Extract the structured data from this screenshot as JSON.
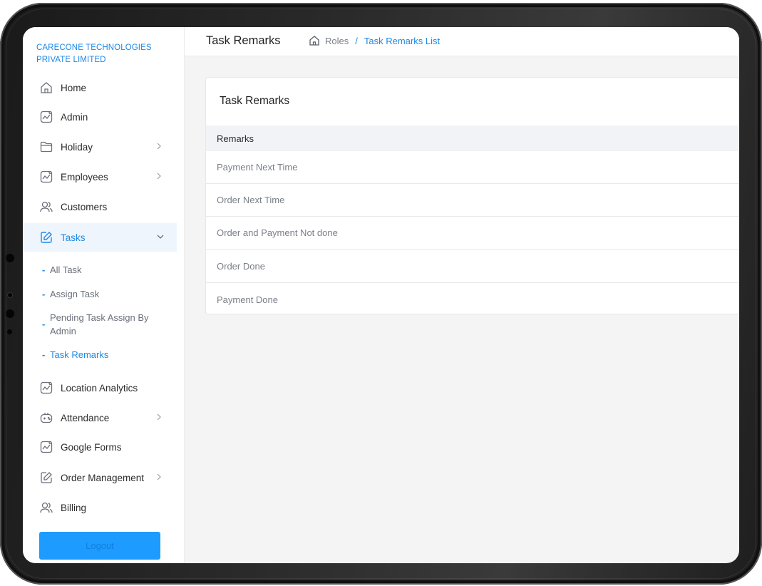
{
  "company": "CARECONE TECHNOLOGIES PRIVATE LIMITED",
  "sidebar": {
    "items": [
      {
        "label": "Home",
        "icon": "home-icon"
      },
      {
        "label": "Admin",
        "icon": "chart-icon"
      },
      {
        "label": "Holiday",
        "icon": "folder-icon",
        "has_submenu": true
      },
      {
        "label": "Employees",
        "icon": "chart-icon",
        "has_submenu": true
      },
      {
        "label": "Customers",
        "icon": "users-icon"
      },
      {
        "label": "Tasks",
        "icon": "edit-icon",
        "expanded": true,
        "active": true
      },
      {
        "label": "Location Analytics",
        "icon": "chart-icon"
      },
      {
        "label": "Attendance",
        "icon": "gamepad-icon",
        "has_submenu": true
      },
      {
        "label": "Google Forms",
        "icon": "chart-icon"
      },
      {
        "label": "Order Management",
        "icon": "edit-icon",
        "has_submenu": true
      },
      {
        "label": "Billing",
        "icon": "users-icon"
      }
    ],
    "task_subitems": [
      {
        "label": "All Task"
      },
      {
        "label": "Assign Task"
      },
      {
        "label": "Pending Task Assign By Admin"
      },
      {
        "label": "Task Remarks",
        "current": true
      }
    ],
    "logout_label": "Logout"
  },
  "header": {
    "title": "Task Remarks",
    "breadcrumb": [
      "Roles",
      "Task Remarks List"
    ],
    "separator": "/"
  },
  "card": {
    "title": "Task Remarks",
    "column_header": "Remarks",
    "rows": [
      "Payment Next Time",
      "Order Next Time",
      "Order and Payment Not done",
      "Order Done",
      "Payment Done"
    ]
  },
  "colors": {
    "accent": "#1e88e5",
    "active_bg": "#eef5fc",
    "logout_bg": "#1e9bff"
  }
}
